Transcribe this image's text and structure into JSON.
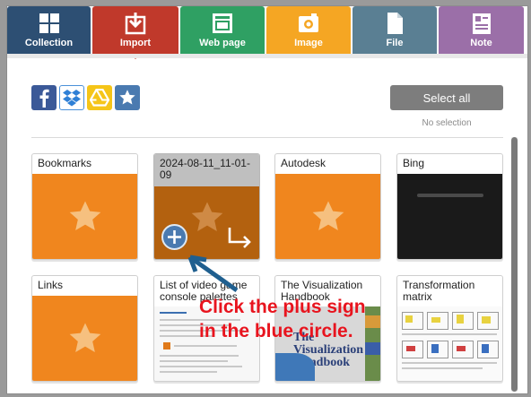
{
  "tabs": [
    {
      "label": "Collection",
      "icon": "collection-grid-icon",
      "color": "#2d4f73"
    },
    {
      "label": "Import",
      "icon": "import-icon",
      "color": "#c0392b",
      "active": true
    },
    {
      "label": "Web page",
      "icon": "web-page-icon",
      "color": "#2fa063"
    },
    {
      "label": "Image",
      "icon": "image-icon",
      "color": "#f5a623"
    },
    {
      "label": "File",
      "icon": "file-icon",
      "color": "#5a7f93"
    },
    {
      "label": "Note",
      "icon": "note-icon",
      "color": "#9b6fa8"
    }
  ],
  "cloud_services": [
    "facebook-icon",
    "dropbox-icon",
    "google-drive-icon",
    "favorites-star-icon"
  ],
  "toolbar": {
    "select_all_label": "Select all",
    "selection_status": "No selection"
  },
  "cards": [
    {
      "title": "Bookmarks",
      "type": "folder"
    },
    {
      "title": "2024-08-11_11-01-09",
      "type": "folder-hover"
    },
    {
      "title": "Autodesk",
      "type": "folder"
    },
    {
      "title": "Bing",
      "type": "web-thumbnail"
    },
    {
      "title": "Links",
      "type": "folder"
    },
    {
      "title": "List of video game console palettes",
      "type": "web-thumbnail"
    },
    {
      "title": "The Visualization Handbook",
      "type": "book-thumbnail",
      "cover_title": "The Visualization Handbook"
    },
    {
      "title": "Transformation matrix",
      "type": "web-thumbnail"
    }
  ],
  "annotation": {
    "text": "Click the plus sign in the blue circle.",
    "color": "#e8141e"
  },
  "colors": {
    "folder_orange": "#f0861e",
    "folder_hover": "#b3610f",
    "plus_circle": "#4a7ab0",
    "arrow": "#1f5f8f"
  }
}
